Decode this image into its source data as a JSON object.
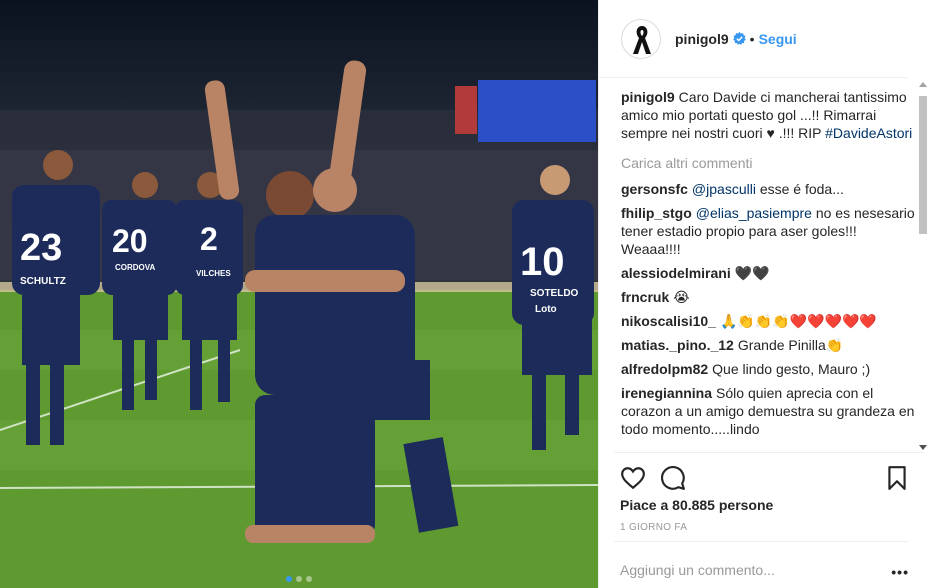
{
  "photo": {
    "jersey_numbers": [
      "23",
      "20",
      "2",
      "10"
    ],
    "jersey_names": [
      "SCHULTZ",
      "CORDOVA",
      "VILCHES",
      "SOTELDO"
    ],
    "sponsor": "Loto"
  },
  "header": {
    "username": "pinigol9",
    "follow_label": "Segui",
    "separator": "•"
  },
  "caption": {
    "username": "pinigol9",
    "text": "Caro Davide ci mancherai tantissimo amico mio portati questo gol ...!! Rimarrai sempre nei nostri cuori ♥ .!!! RIP",
    "hashtag": "#DavideAstori"
  },
  "load_more": "Carica altri commenti",
  "comments": [
    {
      "user": "gersonsfc",
      "mention": "@jpasculli",
      "text": "esse é foda..."
    },
    {
      "user": "fhilip_stgo",
      "mention": "@elias_pasiempre",
      "text": "no es nesesario tener estadio propio para aser goles!!! Weaaa!!!!"
    },
    {
      "user": "alessiodelmirani",
      "mention": "",
      "text": "🖤🖤"
    },
    {
      "user": "frncruk",
      "mention": "",
      "text": "😭"
    },
    {
      "user": "nikoscalisi10_",
      "mention": "",
      "text": "🙏👏👏👏❤️❤️❤️❤️❤️"
    },
    {
      "user": "matias._pino._12",
      "mention": "",
      "text": "Grande Pinilla👏"
    },
    {
      "user": "alfredolpm82",
      "mention": "",
      "text": "Que lindo gesto, Mauro ;)"
    },
    {
      "user": "irenegiannina",
      "mention": "",
      "text": "Sólo quien aprecia con el corazon a un amigo demuestra su grandeza en todo momento.....lindo"
    }
  ],
  "likes_text": "Piace a 80.885 persone",
  "time_ago": "1 GIORNO FA",
  "add_comment": {
    "placeholder": "Aggiungi un commento...",
    "value": ""
  },
  "more_options": "•••",
  "colors": {
    "link": "#3897f0",
    "mention": "#003569",
    "muted": "#999999",
    "border": "#efefef",
    "jersey": "#1c2b5a"
  }
}
